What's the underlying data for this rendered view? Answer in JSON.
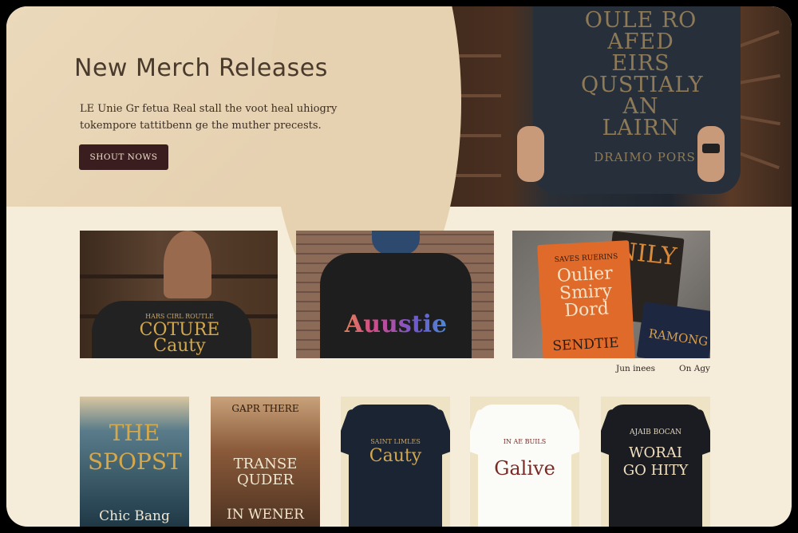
{
  "hero": {
    "title": "New Merch Releases",
    "subtitle_line1": "LE Unie Gr fetua Real stall the voot heal uhiogry",
    "subtitle_line2": "tokempore tattitbenn ge the muther precests.",
    "cta_label": "SHOUT NOWS",
    "photo_tee_text": "OULE RO AFED EIRS QUSTIALY AN LAIRN",
    "photo_tee_sub": "DRAIMO PORS"
  },
  "features": [
    {
      "tee_text_top": "HARS CIRL ROUTLE",
      "tee_text_main": "COTURE Cauty"
    },
    {
      "tee_text_main": "Auustie"
    },
    {
      "book_top": "SAVES RUERINS",
      "book_main": "Oulier Smiry Dord",
      "book_bottom": "SENDTIE",
      "book_side": "NILY",
      "book_small": "RAMONG"
    }
  ],
  "captions": {
    "left": "Jun inees",
    "right": "On Agy"
  },
  "products": [
    {
      "top": "",
      "main": "THE SPOPST",
      "bottom": "Chic Bang"
    },
    {
      "top": "GAPR THERE",
      "main": "TRANSE QUDER",
      "bottom": "IN WENER"
    },
    {
      "top": "SAINT LIMLES",
      "main": "Cauty"
    },
    {
      "top": "IN AE BUILS",
      "main": "Galive"
    },
    {
      "top": "AJAIB BOCAN",
      "main": "WORAI GO HITY"
    }
  ],
  "colors": {
    "hero_bg": "#e6d2b0",
    "page_bg": "#f5ecd9",
    "cta_bg": "#3a1d1e",
    "title_text": "#4a3a2c"
  }
}
